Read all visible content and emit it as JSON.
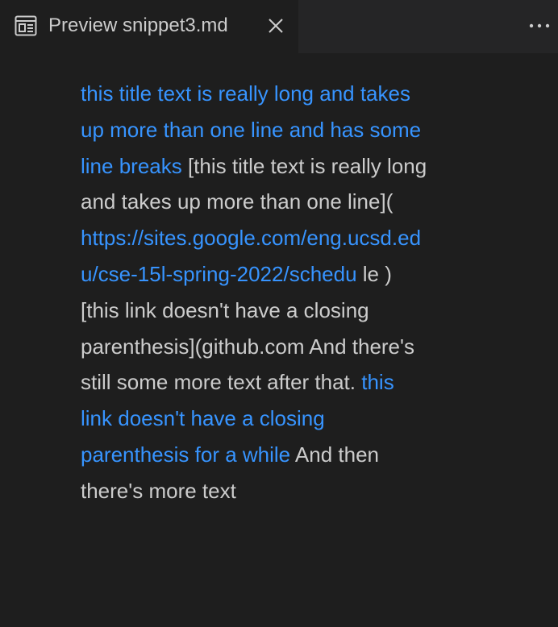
{
  "tab": {
    "title": "Preview snippet3.md",
    "icon": "preview-icon",
    "close_icon": "close-icon"
  },
  "toolbar": {
    "more_icon": "more-actions-icon"
  },
  "colors": {
    "background": "#1e1e1e",
    "text": "#cccccc",
    "link": "#3794ff"
  },
  "content": {
    "l1": "this title text is really long and takes",
    "l2": "up more than one line and has some",
    "l3_link": "line breaks",
    "l3_text": " [this title text is really long",
    "l4": "and takes up more than one line](",
    "l5": "https://sites.google.com/eng.ucsd.ed",
    "l6_link": "u/cse-15l-spring-2022/schedu",
    "l6_text": " le )",
    "l7": "[this link doesn't have a closing",
    "l8": "parenthesis](github.com And there's",
    "l9_text": "still some more text after that. ",
    "l9_link": "this",
    "l10": "link doesn't have a closing",
    "l11_link": "parenthesis for a while",
    "l11_text": " And then",
    "l12": "there's more text"
  }
}
